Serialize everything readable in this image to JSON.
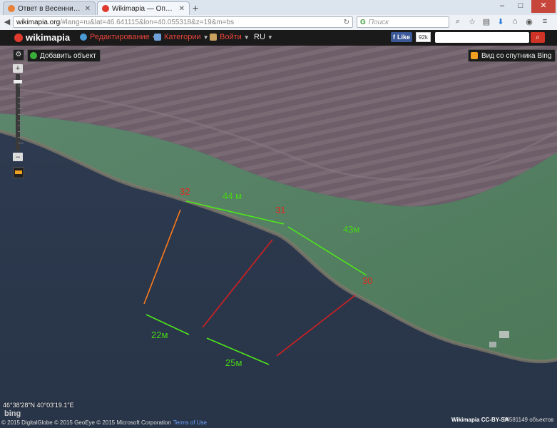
{
  "browser": {
    "tabs": [
      {
        "title": "Ответ в Весенний карп на...",
        "active": false
      },
      {
        "title": "Wikimapia — Опишем ве...",
        "active": true
      }
    ],
    "new_tab_label": "+",
    "window_controls": [
      "–",
      "□",
      "✕"
    ],
    "url_host": "wikimapia.org",
    "url_path": "/#lang=ru&lat=46.641115&lon=40.055318&z=19&m=bs",
    "reload_icon": "reload-icon",
    "search_placeholder": "Поиск"
  },
  "site": {
    "logo_text": "wikimapia",
    "menu": {
      "edit": "Редактирование",
      "categories": "Категории",
      "login": "Войти",
      "lang": "RU"
    },
    "like_label": "Like",
    "like_count": "92k",
    "search_button_icon": "search-icon"
  },
  "map": {
    "add_object": "Добавить объект",
    "satellite_toggle": "Вид со спутника Bing",
    "zoom_in": "+",
    "zoom_out": "–",
    "labels": {
      "p32": "32",
      "p31": "31",
      "p30": "30",
      "d44": "44 м",
      "d43": "43м",
      "d22": "22м",
      "d25": "25м"
    },
    "coordinates": "46°38'28\"N 40°03'19.1\"E",
    "bing_logo": "bing",
    "copyright": "© 2015 DigitalGlobe © 2015 GeoEye © 2015 Microsoft Corporation",
    "terms_link": "Terms of Use",
    "license": "Wikimapia CC-BY-SA",
    "object_count": "24581149 объектов",
    "colors": {
      "red_label": "#e0291e",
      "green_label": "#47d617",
      "orange_line": "#ff7a1a",
      "red_line": "#d42020",
      "green_line": "#4ee81a"
    }
  }
}
